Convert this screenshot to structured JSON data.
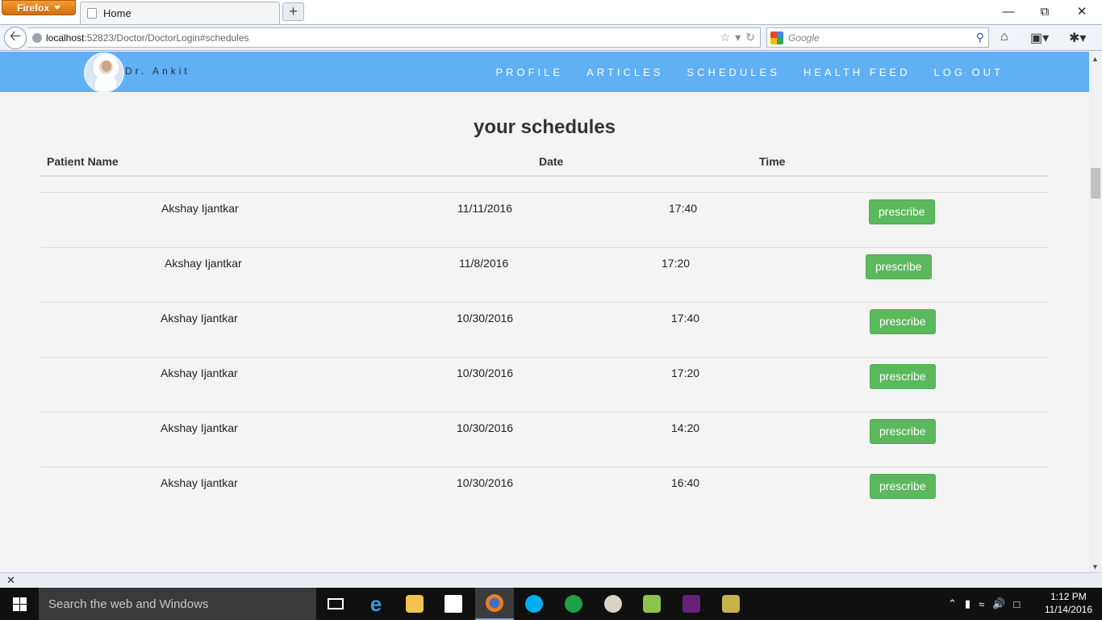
{
  "browser": {
    "app_button": "Firefox",
    "tab_title": "Home",
    "url_host": "localhost",
    "url_rest": ":52823/Doctor/DoctorLogin#schedules",
    "search_placeholder": "Google"
  },
  "site": {
    "brand": "Dr. Ankit",
    "nav": [
      "PROFILE",
      "ARTICLES",
      "SCHEDULES",
      "HEALTH FEED",
      "LOG OUT"
    ]
  },
  "schedules": {
    "heading": "your schedules",
    "columns": [
      "Patient Name",
      "Date",
      "Time"
    ],
    "button_label": "prescribe",
    "rows": [
      {
        "name": "Akshay Ijantkar",
        "date": "11/11/2016",
        "time": "17:40"
      },
      {
        "name": "Akshay Ijantkar",
        "date": "11/8/2016",
        "time": "17:20"
      },
      {
        "name": "Akshay Ijantkar",
        "date": "10/30/2016",
        "time": "17:40"
      },
      {
        "name": "Akshay Ijantkar",
        "date": "10/30/2016",
        "time": "17:20"
      },
      {
        "name": "Akshay Ijantkar",
        "date": "10/30/2016",
        "time": "14:20"
      },
      {
        "name": "Akshay Ijantkar",
        "date": "10/30/2016",
        "time": "16:40"
      }
    ]
  },
  "taskbar": {
    "search_placeholder": "Search the web and Windows",
    "time": "1:12 PM",
    "date": "11/14/2016"
  },
  "colors": {
    "header_bg": "#5fb0f5",
    "button_bg": "#5cb85c"
  }
}
